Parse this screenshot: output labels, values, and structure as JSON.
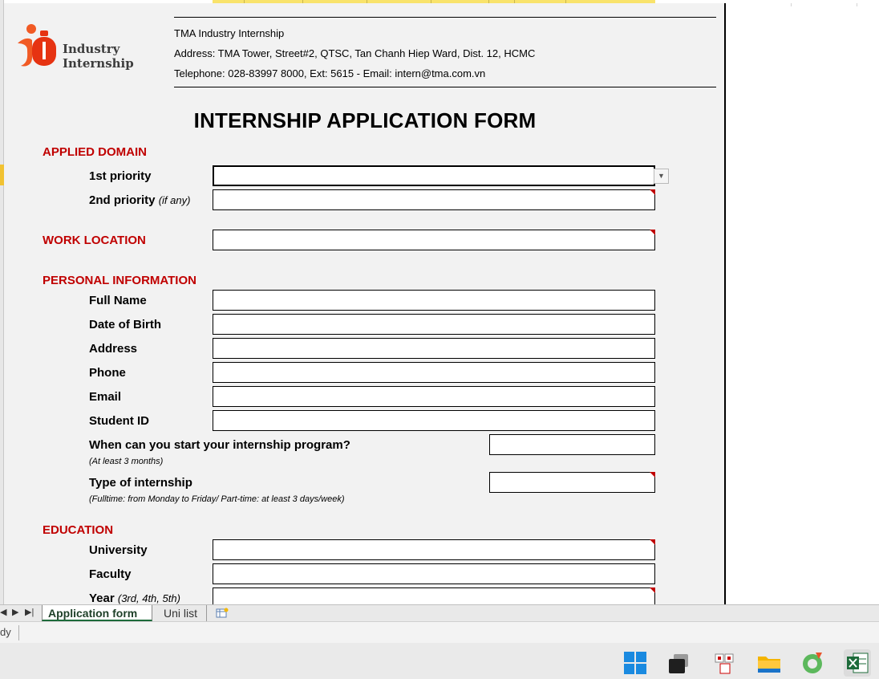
{
  "logo": {
    "line1": "Industry",
    "line2": "Internship"
  },
  "organization": {
    "name": "TMA Industry Internship",
    "address": "Address: TMA Tower, Street#2, QTSC, Tan Chanh Hiep Ward, Dist. 12, HCMC",
    "contact": "Telephone: 028-83997 8000, Ext: 5615 - Email: intern@tma.com.vn"
  },
  "form": {
    "title": "INTERNSHIP APPLICATION FORM",
    "sections": {
      "applied_domain": "APPLIED DOMAIN",
      "work_location": "WORK LOCATION",
      "personal_information": "PERSONAL INFORMATION",
      "education": "EDUCATION"
    },
    "labels": {
      "priority_1": "1st priority",
      "priority_2": "2nd priority",
      "priority_2_note": "(if any)",
      "full_name": "Full Name",
      "date_of_birth": "Date of Birth",
      "address": "Address",
      "phone": "Phone",
      "email": "Email",
      "student_id": "Student ID",
      "start_date": "When can you start your internship program?",
      "start_date_hint": "(At least 3 months)",
      "internship_type": "Type of internship",
      "internship_type_hint": "(Fulltime: from Monday to Friday/ Part-time: at least 3 days/week)",
      "university": "University",
      "faculty": "Faculty",
      "year": "Year",
      "year_note": "(3rd, 4th, 5th)"
    },
    "values": {
      "priority_1": "",
      "priority_2": "",
      "work_location": "",
      "full_name": "",
      "date_of_birth": "",
      "address": "",
      "phone": "",
      "email": "",
      "student_id": "",
      "start_date": "",
      "internship_type": "",
      "university": "",
      "faculty": "",
      "year": ""
    }
  },
  "sheet_tabs": [
    {
      "label": "Application form",
      "active": true
    },
    {
      "label": "Uni list",
      "active": false
    }
  ],
  "status_bar": {
    "text": "dy"
  },
  "taskbar": {
    "icons": [
      "windows-start-icon",
      "task-view-icon",
      "app-icon",
      "file-explorer-icon",
      "browser-icon",
      "excel-icon"
    ]
  },
  "colors": {
    "section_heading": "#c00000",
    "background": "#f2f2f2",
    "accent": "#f15a24"
  }
}
